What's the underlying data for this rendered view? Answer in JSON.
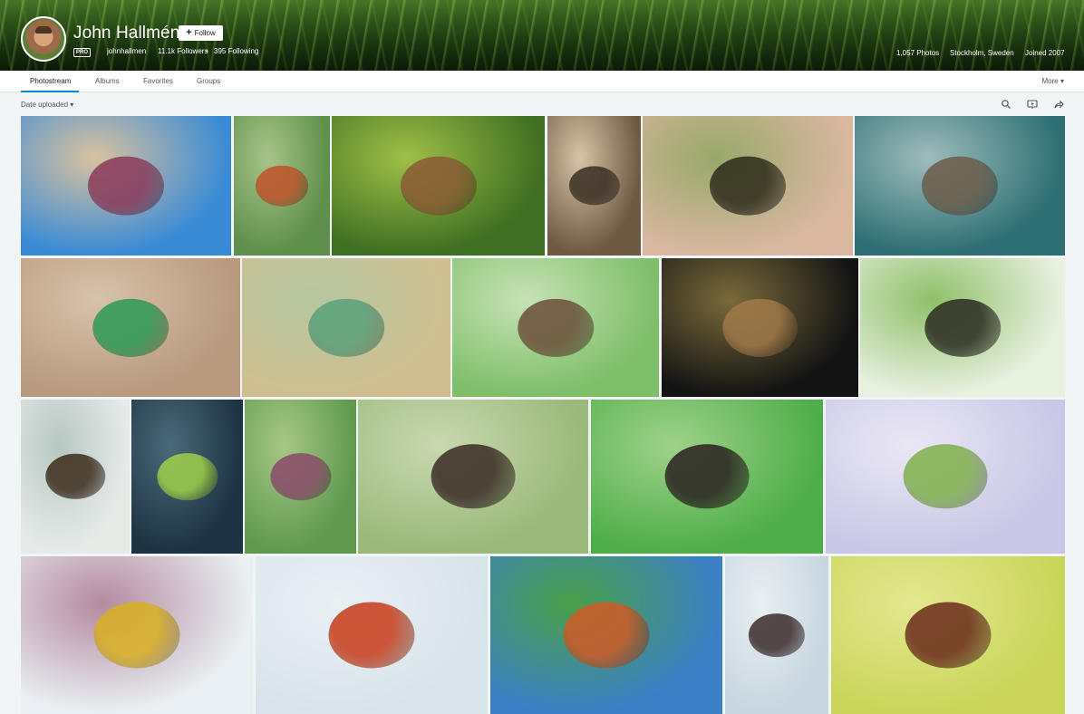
{
  "profile": {
    "name": "John Hallmén",
    "follow_label": "Follow",
    "pro_badge": "PRO",
    "username": "johnhallmen",
    "followers": "11.1k Followers",
    "separator": "•",
    "following": "395 Following",
    "photos": "1,057 Photos",
    "location": "Stockholm, Sweden",
    "joined": "Joined 2007"
  },
  "nav": {
    "tabs": [
      {
        "label": "Photostream"
      },
      {
        "label": "Albums"
      },
      {
        "label": "Favorites"
      },
      {
        "label": "Groups"
      }
    ],
    "more_label": "More"
  },
  "toolbar": {
    "sort_label": "Date uploaded",
    "icons": [
      "search-icon",
      "slideshow-icon",
      "share-icon"
    ]
  },
  "photos": [
    {
      "name": "photo-caterpillar",
      "colors": [
        "#3a8bd6",
        "#d9c2a0",
        "#8a3a5a"
      ]
    },
    {
      "name": "photo-wasp-on-twig",
      "colors": [
        "#5f8f4c",
        "#a7c48a",
        "#c0522a"
      ]
    },
    {
      "name": "photo-leaf-bug",
      "colors": [
        "#3f6f22",
        "#9fbf47",
        "#8a5a35"
      ]
    },
    {
      "name": "photo-spider-on-stem",
      "colors": [
        "#6e5a43",
        "#d7c3a6",
        "#3a2f25"
      ]
    },
    {
      "name": "photo-wasp-on-flower",
      "colors": [
        "#d9b7a0",
        "#98a86a",
        "#2c2a1a"
      ]
    },
    {
      "name": "photo-moth-on-grass",
      "colors": [
        "#2d6f73",
        "#9fbcbc",
        "#6b5c4a"
      ]
    },
    {
      "name": "photo-green-beetle",
      "colors": [
        "#b89a7f",
        "#d7c2aa",
        "#2b9a55"
      ]
    },
    {
      "name": "photo-damselfly",
      "colors": [
        "#cfbf90",
        "#b5c7a1",
        "#5aa07a"
      ]
    },
    {
      "name": "photo-weevil",
      "colors": [
        "#7fbf6a",
        "#c7e2b5",
        "#6b4e3a"
      ]
    },
    {
      "name": "photo-toad",
      "colors": [
        "#141414",
        "#7a6a3a",
        "#a07a4a"
      ]
    },
    {
      "name": "photo-hoverfly-on-fern",
      "colors": [
        "#e8f0e0",
        "#8fc06a",
        "#2a2a20"
      ]
    },
    {
      "name": "photo-hoverfly-closeup",
      "colors": [
        "#e6ebe8",
        "#b8c7c2",
        "#3a2a1a"
      ]
    },
    {
      "name": "photo-green-spider-dark",
      "colors": [
        "#1d3342",
        "#4a6a7a",
        "#9fd04a"
      ]
    },
    {
      "name": "photo-green-spider-bud",
      "colors": [
        "#5f9a50",
        "#a8c787",
        "#8a4a6a"
      ]
    },
    {
      "name": "photo-spider-on-branch",
      "colors": [
        "#9ab97a",
        "#c9d8b0",
        "#3a2a25"
      ]
    },
    {
      "name": "photo-cucumber-spider",
      "colors": [
        "#4fae4a",
        "#9fd28a",
        "#2a2020"
      ]
    },
    {
      "name": "photo-mayfly",
      "colors": [
        "#c9c7e5",
        "#eae8f5",
        "#7fb04a"
      ]
    },
    {
      "name": "photo-wasp-on-petals",
      "colors": [
        "#e9eff2",
        "#b58aa0",
        "#d9b020"
      ]
    },
    {
      "name": "photo-red-spider",
      "colors": [
        "#d9e4ea",
        "#e8f0f4",
        "#c83a18"
      ]
    },
    {
      "name": "photo-spider-in-grass",
      "colors": [
        "#3a7fc6",
        "#4aa04a",
        "#d05a25"
      ]
    },
    {
      "name": "photo-shield-bugs",
      "colors": [
        "#c9d6e0",
        "#e9eff2",
        "#3a2a2a"
      ]
    },
    {
      "name": "photo-beetles-on-grass",
      "colors": [
        "#c9d65a",
        "#e3e890",
        "#6a2a1a"
      ]
    }
  ]
}
